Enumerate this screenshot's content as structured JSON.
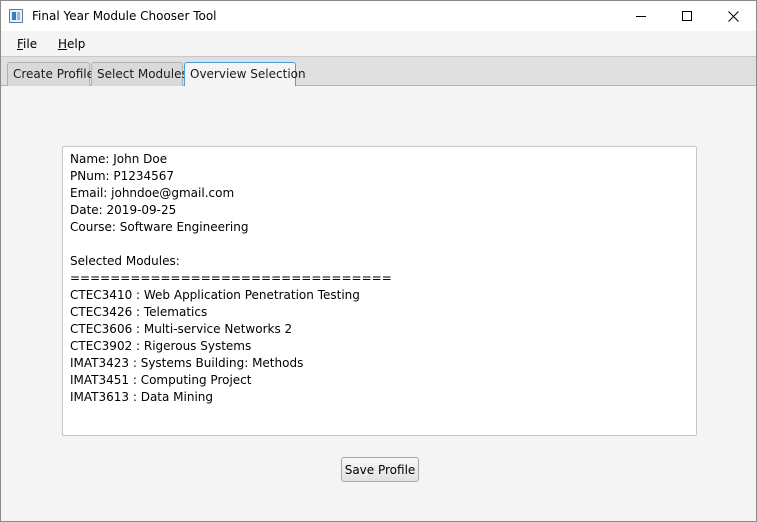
{
  "window": {
    "title": "Final Year Module Chooser Tool"
  },
  "menu": {
    "file_mnemonic": "F",
    "file_rest": "ile",
    "help_mnemonic": "H",
    "help_rest": "elp"
  },
  "tabs": [
    {
      "label": "Create Profile"
    },
    {
      "label": "Select Modules"
    },
    {
      "label": "Overview Selection",
      "selected": true
    }
  ],
  "overview": {
    "lines": [
      "Name: John Doe",
      "PNum: P1234567",
      "Email: johndoe@gmail.com",
      "Date: 2019-09-25",
      "Course: Software Engineering",
      "",
      "Selected Modules:",
      "================================",
      "CTEC3410 : Web Application Penetration Testing",
      "CTEC3426 : Telematics",
      "CTEC3606 : Multi-service Networks 2",
      "CTEC3902 : Rigerous Systems",
      "IMAT3423 : Systems Building: Methods",
      "IMAT3451 : Computing Project",
      "IMAT3613 : Data Mining"
    ]
  },
  "actions": {
    "save_label": "Save Profile"
  },
  "icons": {
    "app": "app-window-icon",
    "minimize": "minimize-icon",
    "maximize": "maximize-icon",
    "close": "close-icon"
  }
}
